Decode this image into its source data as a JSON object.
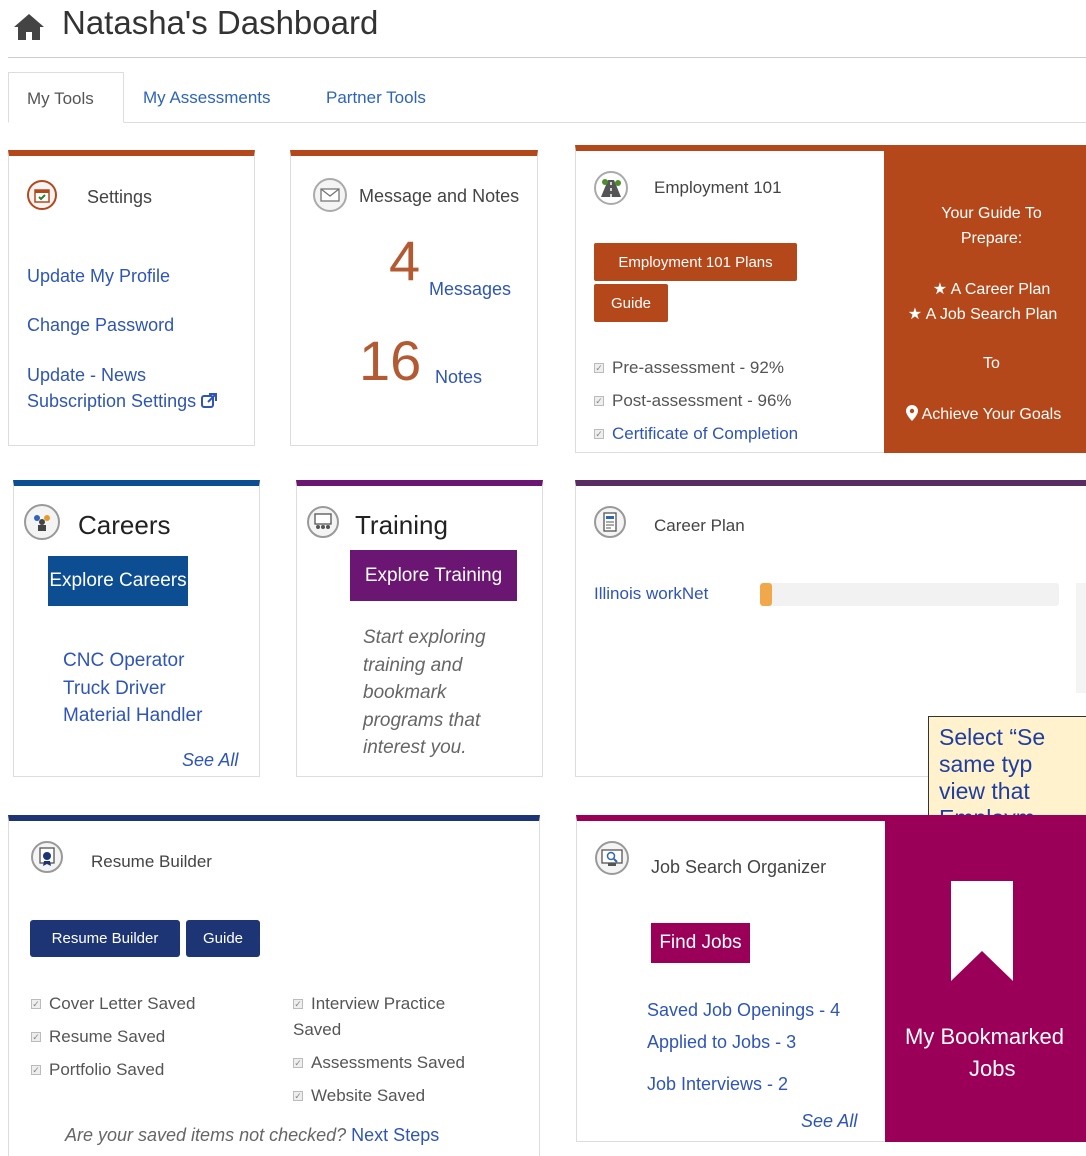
{
  "header": {
    "title": "Natasha's Dashboard"
  },
  "tabs": [
    {
      "label": "My Tools",
      "active": true
    },
    {
      "label": "My Assessments"
    },
    {
      "label": "Partner Tools"
    }
  ],
  "settings": {
    "title": "Settings",
    "links": [
      "Update My Profile",
      "Change Password",
      "Update - News",
      "Subscription Settings"
    ]
  },
  "messages": {
    "title": "Message and Notes",
    "messages_count": "4",
    "messages_label": "Messages",
    "notes_count": "16",
    "notes_label": "Notes"
  },
  "employment101": {
    "title": "Employment 101",
    "plans_button": "Employment 101 Plans",
    "guide_button": "Guide",
    "checks": [
      "Pre-assessment - 92%",
      "Post-assessment - 96%",
      "Certificate of Completion"
    ],
    "promo": {
      "line1": "Your Guide To",
      "line2": "Prepare:",
      "item1": "A Career Plan",
      "item2": "A Job Search Plan",
      "to": "To",
      "goal": "Achieve Your Goals"
    }
  },
  "careers": {
    "title": "Careers",
    "button": "Explore Careers",
    "items": [
      "CNC Operator",
      "Truck Driver",
      "Material Handler"
    ],
    "see_all": "See All"
  },
  "training": {
    "title": "Training",
    "button": "Explore Training",
    "text_lines": [
      "Start exploring",
      "training and",
      "bookmark",
      "programs that",
      "interest you."
    ]
  },
  "career_plan": {
    "title": "Career Plan",
    "row_label": "Illinois workNet",
    "progress_fraction": 0.04
  },
  "tooltip": {
    "lines": [
      "Select “Se",
      "same typ",
      "view that",
      "Employm"
    ]
  },
  "resume": {
    "title": "Resume Builder",
    "builder_button": "Resume Builder",
    "guide_button": "Guide",
    "checks_left": [
      "Cover Letter Saved",
      "Resume Saved",
      "Portfolio Saved"
    ],
    "checks_right_1a": "Interview Practice",
    "checks_right_1b": "Saved",
    "checks_right_2": "Assessments Saved",
    "checks_right_3": "Website Saved",
    "footer_question": "Are your saved items not checked?",
    "footer_link": "Next Steps"
  },
  "job_search": {
    "title": "Job Search Organizer",
    "button": "Find Jobs",
    "links": [
      "Saved Job Openings - 4",
      "Applied to Jobs - 3",
      "Job Interviews - 2"
    ],
    "see_all": "See All",
    "bookmark_line1": "My Bookmarked",
    "bookmark_line2": "Jobs"
  },
  "colors": {
    "orange": "#b5481a",
    "blue": "#0d4d92",
    "purple": "#6a1672",
    "navy": "#1e3575",
    "magenta": "#9a0058"
  }
}
